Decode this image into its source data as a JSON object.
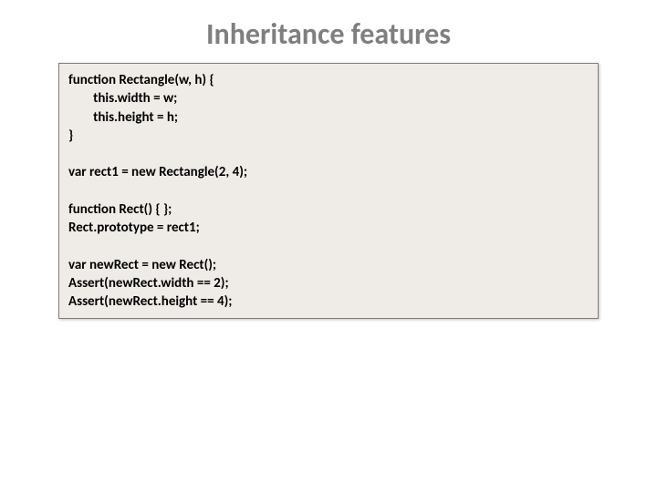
{
  "title": "Inheritance features",
  "code": {
    "l1": "function Rectangle(w, h) {",
    "l2": "        this.width = w;",
    "l3": "        this.height = h;",
    "l4": "}",
    "l5": " ",
    "l6": "var rect1 = new Rectangle(2, 4);",
    "l7": " ",
    "l8": "function Rect() { };",
    "l9": "Rect.prototype = rect1;",
    "l10": " ",
    "l11": "var newRect = new Rect();",
    "l12": "Assert(newRect.width == 2);",
    "l13": "Assert(newRect.height == 4);"
  }
}
